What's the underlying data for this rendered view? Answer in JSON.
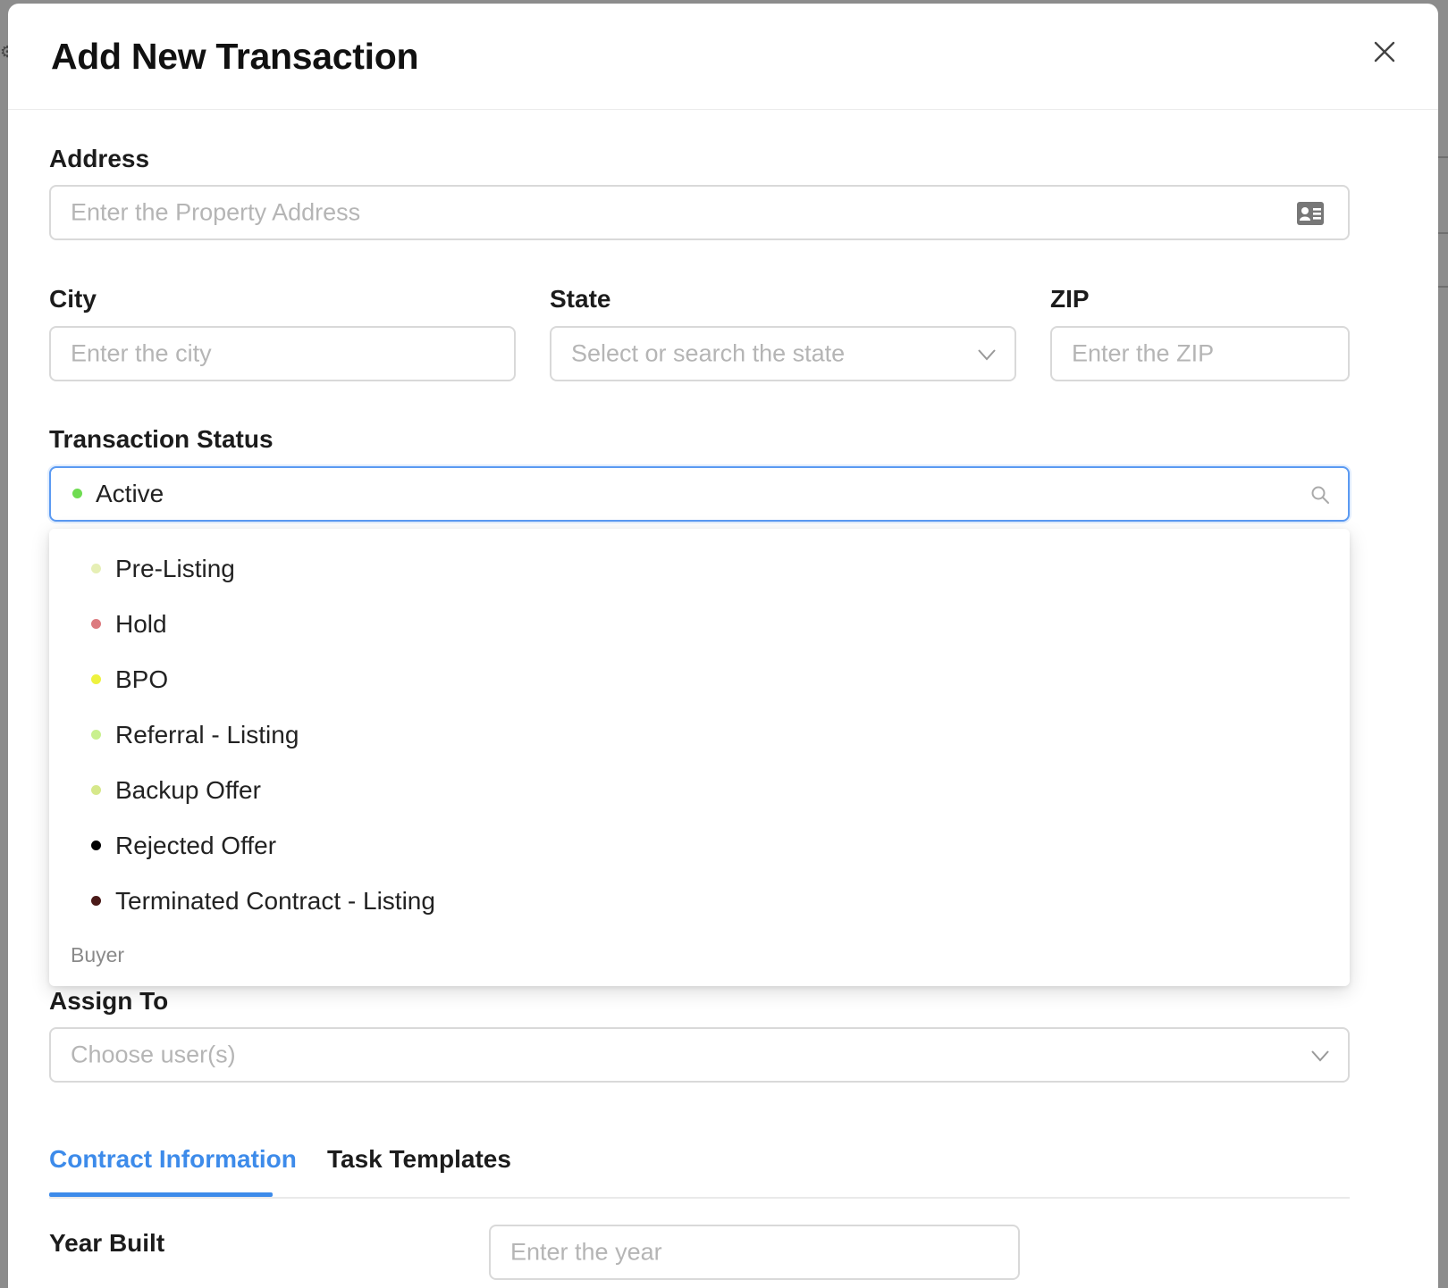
{
  "modal": {
    "title": "Add New Transaction"
  },
  "address": {
    "label": "Address",
    "placeholder": "Enter the Property Address"
  },
  "city": {
    "label": "City",
    "placeholder": "Enter the city"
  },
  "state": {
    "label": "State",
    "placeholder": "Select or search the state"
  },
  "zip": {
    "label": "ZIP",
    "placeholder": "Enter the ZIP"
  },
  "transaction_status": {
    "label": "Transaction Status",
    "value": "Active",
    "value_color": "#6fdc52",
    "options": [
      {
        "label": "Pre-Listing",
        "color": "#e6efb5"
      },
      {
        "label": "Hold",
        "color": "#dc7a7f"
      },
      {
        "label": "BPO",
        "color": "#eef23e"
      },
      {
        "label": "Referral - Listing",
        "color": "#c9f08e"
      },
      {
        "label": "Backup Offer",
        "color": "#d6e88a"
      },
      {
        "label": "Rejected Offer",
        "color": "#000000"
      },
      {
        "label": "Terminated Contract - Listing",
        "color": "#4a1a18"
      }
    ],
    "next_group": "Buyer"
  },
  "assign_to": {
    "label": "Assign To",
    "placeholder": "Choose user(s)"
  },
  "tabs": [
    {
      "label": "Contract Information",
      "active": true
    },
    {
      "label": "Task Templates",
      "active": false
    }
  ],
  "year_built": {
    "label": "Year Built",
    "placeholder": "Enter the year"
  },
  "colors": {
    "accent": "#3d8bea",
    "focus_border": "#5b9af2"
  }
}
